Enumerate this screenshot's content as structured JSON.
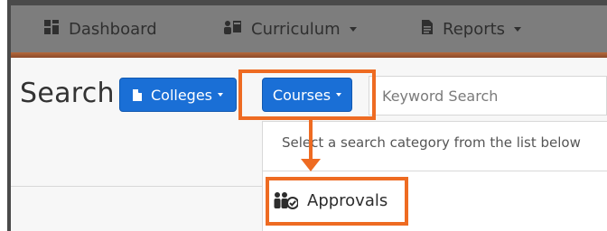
{
  "nav": {
    "dashboard": "Dashboard",
    "curriculum": "Curriculum",
    "reports": "Reports"
  },
  "page": {
    "title": "Search"
  },
  "buttons": {
    "colleges": "Colleges",
    "courses": "Courses"
  },
  "search": {
    "placeholder": "Keyword Search"
  },
  "dropdown": {
    "hint": "Select a search category from the list below",
    "items": [
      "Approvals"
    ]
  },
  "colors": {
    "highlight": "#ee6b22",
    "button": "#1a6fd6",
    "nav_bar": "#7d7d7d"
  },
  "icons": {
    "dashboard": "dashboard-icon",
    "curriculum": "curriculum-icon",
    "reports": "reports-icon",
    "colleges": "document-icon",
    "approvals": "people-check-icon"
  }
}
